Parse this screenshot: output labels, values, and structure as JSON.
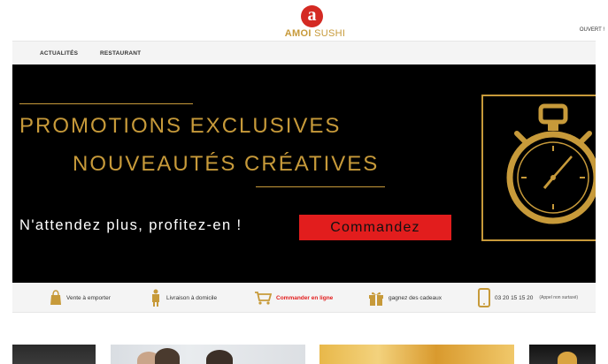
{
  "header": {
    "logo_badge": "a",
    "logo_word1": "AMOI",
    "logo_word2": "SUSHI",
    "status": "OUVERT !"
  },
  "nav": {
    "items": [
      "ACTUALITÉS",
      "RESTAURANT"
    ]
  },
  "hero": {
    "title_line1": "PROMOTIONS EXCLUSIVES",
    "title_line2": "NOUVEAUTÉS CRÉATIVES",
    "subtitle": "N'attendez plus, profitez-en !",
    "cta_label": "Commandez",
    "accent_color": "#c79a3a",
    "cta_color": "#e21d1d"
  },
  "services": [
    {
      "label": "Vente à emporter",
      "icon": "shopping-bag-icon"
    },
    {
      "label": "Livraison à domicile",
      "icon": "delivery-icon"
    },
    {
      "label": "Commander en ligne",
      "icon": "cart-icon"
    },
    {
      "label": "gagnez des cadeaux",
      "icon": "gift-icon"
    },
    {
      "label": "03 20 15 15 20",
      "note": "(Appel non surtaxé)",
      "icon": "phone-icon"
    }
  ]
}
